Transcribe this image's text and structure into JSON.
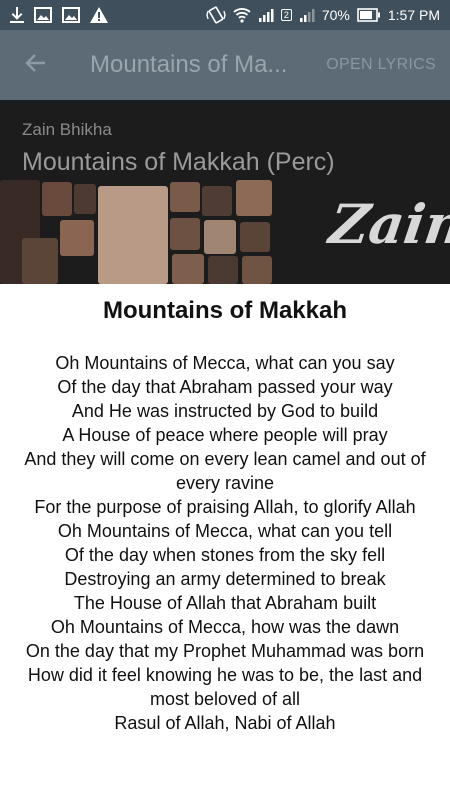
{
  "status_bar": {
    "battery_percent": "70%",
    "time": "1:57 PM",
    "sim_badge": "2"
  },
  "app_bar": {
    "title": "Mountains of Ma...",
    "action_label": "OPEN LYRICS"
  },
  "header": {
    "artist": "Zain Bhikha",
    "song_title": "Mountains of Makkah (Perc)",
    "banner_text": "Zain B"
  },
  "lyrics": {
    "heading": "Mountains of Makkah",
    "lines": [
      "Oh Mountains of Mecca, what can you say",
      "Of the day that Abraham passed your way",
      "And He was instructed by God to build",
      "A House of peace where people will pray",
      "And they will come on every lean camel and out of every ravine",
      "For the purpose of praising Allah, to glorify Allah",
      "Oh Mountains of Mecca, what can you tell",
      "Of the day when stones from the sky fell",
      "Destroying an army determined to break",
      "The House of Allah that Abraham built",
      "Oh Mountains of Mecca, how was the dawn",
      "On the day that my Prophet Muhammad was born",
      "How did it feel knowing he was to be, the last and most beloved of all",
      "Rasul of Allah, Nabi of Allah"
    ]
  }
}
